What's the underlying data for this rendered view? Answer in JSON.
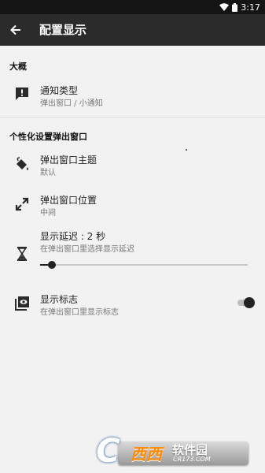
{
  "status_bar": {
    "time": "3:17",
    "wifi_icon": "wifi-icon",
    "battery_icon": "battery-icon"
  },
  "toolbar": {
    "title": "配置显示",
    "back_icon": "arrow-left-icon"
  },
  "sections": {
    "overview": {
      "header": "大概"
    },
    "popup": {
      "header": "个性化设置弹出窗口"
    }
  },
  "items": {
    "notification_type": {
      "title": "通知类型",
      "subtitle": "弹出窗口 / 小通知",
      "icon": "message-alert-icon"
    },
    "popup_theme": {
      "title": "弹出窗口主题",
      "subtitle": "默认",
      "icon": "paint-bucket-icon"
    },
    "popup_position": {
      "title": "弹出窗口位置",
      "subtitle": "中间",
      "icon": "arrows-expand-icon"
    },
    "display_delay": {
      "title": "显示延迟 : 2 秒",
      "subtitle": "在弹出窗口里选择显示延迟",
      "icon": "hourglass-icon",
      "slider_value": 0.04
    },
    "show_badge": {
      "title": "显示标志",
      "subtitle": "在弹出窗口里显示标志",
      "icon": "badge-eye-icon",
      "enabled": true
    }
  },
  "watermark": {
    "logo_letter": "C",
    "text_main": "西西",
    "text_right": "软件园",
    "text_url": "CR173.COM"
  }
}
